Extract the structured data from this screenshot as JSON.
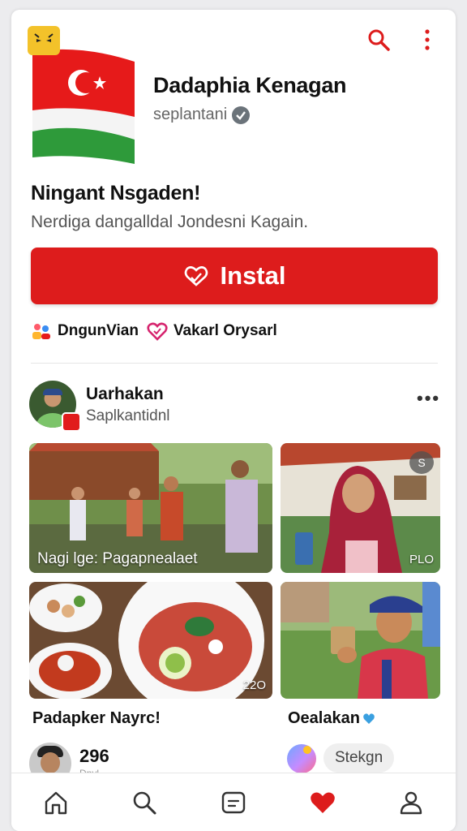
{
  "app": {
    "title": "Dadaphia Kenagan",
    "developer": "seplantani"
  },
  "headline": "Ningant Nsgaden!",
  "subline": "Nerdiga dangalldal Jondesni Kagain.",
  "install_label": "Instal",
  "chips": [
    {
      "label": "DngunVian",
      "icon": "people-icon"
    },
    {
      "label": "Vakarl Orysarl",
      "icon": "heart-icon"
    }
  ],
  "post": {
    "author": "Uarhakan",
    "author_sub": "Saplkantidnl",
    "tiles": [
      {
        "caption": "Nagi lge: Pagapnealaet",
        "icon": "group-photo"
      },
      {
        "count": "PLO",
        "corner": "S",
        "icon": "woman-phone-photo"
      },
      {
        "count": "22O",
        "icon": "food-photo"
      },
      {
        "icon": "boy-phone-photo"
      }
    ]
  },
  "cards": [
    {
      "title": "Padapker Nayrc!",
      "number": "296",
      "number_sub": "Dnyl"
    },
    {
      "title": "Oealakan",
      "button": "Stekgn"
    }
  ],
  "nav": [
    "home-icon",
    "search-icon",
    "messages-icon",
    "favorites-icon",
    "profile-icon"
  ],
  "colors": {
    "accent": "#dd1c1c",
    "badge": "#f3c22a"
  }
}
